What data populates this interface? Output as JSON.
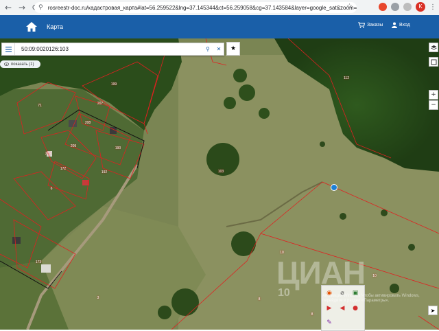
{
  "browser": {
    "url": "rosreestr-doc.ru/кадастровая_карта#lat=56.259522&lng=37.145344&ct=56.259058&cg=37.143584&layer=google_sat&zoom=18",
    "avatar_letter": "K",
    "icons": {
      "back": "arrow-left",
      "forward": "arrow-right",
      "reload": "reload",
      "tune": "tune",
      "star": "star",
      "menu": "kebab"
    }
  },
  "header": {
    "tab_label": "Карта",
    "orders_label": "Заказы",
    "login_label": "Вход",
    "color": "#1a5fa8"
  },
  "search": {
    "value": "50:09:0020126:103"
  },
  "show_pill": {
    "label": "показать (1)"
  },
  "parcels": [
    {
      "id": "199"
    },
    {
      "id": "71"
    },
    {
      "id": "207"
    },
    {
      "id": "208"
    },
    {
      "id": "209"
    },
    {
      "id": "190"
    },
    {
      "id": "172"
    },
    {
      "id": "192"
    },
    {
      "id": "6"
    },
    {
      "id": "206"
    },
    {
      "id": "173"
    },
    {
      "id": "3"
    },
    {
      "id": "103"
    },
    {
      "id": "112"
    },
    {
      "id": "10"
    },
    {
      "id": "10"
    },
    {
      "id": "8"
    },
    {
      "id": "8"
    }
  ],
  "watermark": {
    "text": "ЦИАН",
    "sub": "10",
    "activation": "Активация Windows\nЧтобы активировать Windows, перейдите в раздел «Параметры»."
  },
  "controls": {
    "layers_icon": "layers-icon",
    "zoom_in": "+",
    "zoom_out": "−"
  },
  "colors": {
    "boundary": "#e02020",
    "marker": "#1e7fd6",
    "header": "#1a5fa8"
  }
}
